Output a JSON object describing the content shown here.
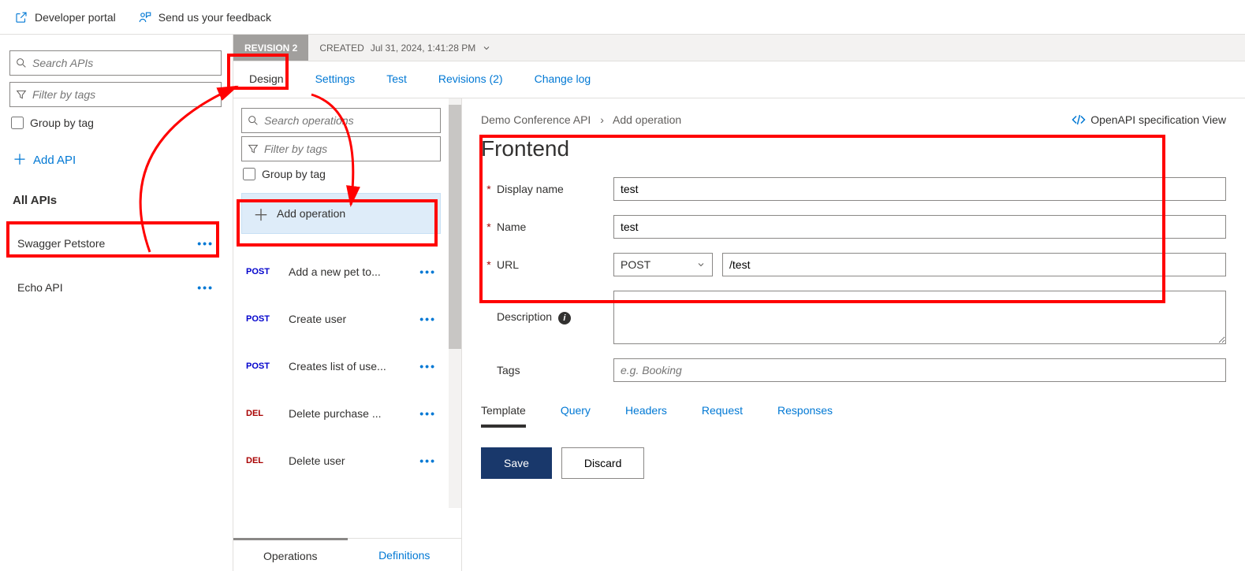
{
  "topbar": {
    "developer_portal": "Developer portal",
    "feedback": "Send us your feedback"
  },
  "sidebar": {
    "search_placeholder": "Search APIs",
    "filter_placeholder": "Filter by tags",
    "group_by_tag": "Group by tag",
    "add_api": "Add API",
    "all_apis": "All APIs",
    "apis": [
      {
        "name": "Swagger Petstore"
      },
      {
        "name": "Echo API"
      }
    ]
  },
  "revision": {
    "label": "REVISION 2",
    "created_label": "CREATED",
    "created_value": "Jul 31, 2024, 1:41:28 PM"
  },
  "tabs": {
    "design": "Design",
    "settings": "Settings",
    "test": "Test",
    "revisions": "Revisions (2)",
    "changelog": "Change log"
  },
  "ops": {
    "search_placeholder": "Search operations",
    "filter_placeholder": "Filter by tags",
    "group_by_tag": "Group by tag",
    "add_operation": "Add operation",
    "list": [
      {
        "method": "POST",
        "method_class": "post",
        "label": "Add a new pet to..."
      },
      {
        "method": "POST",
        "method_class": "post",
        "label": "Create user"
      },
      {
        "method": "POST",
        "method_class": "post",
        "label": "Creates list of use..."
      },
      {
        "method": "DEL",
        "method_class": "del",
        "label": "Delete purchase ..."
      },
      {
        "method": "DEL",
        "method_class": "del",
        "label": "Delete user"
      }
    ],
    "bottom_tabs": {
      "operations": "Operations",
      "definitions": "Definitions"
    }
  },
  "breadcrumb": {
    "api": "Demo Conference API",
    "op": "Add operation"
  },
  "openapi_link": "OpenAPI specification View",
  "frontend": {
    "heading": "Frontend",
    "display_name_label": "Display name",
    "display_name_value": "test",
    "name_label": "Name",
    "name_value": "test",
    "url_label": "URL",
    "url_method": "POST",
    "url_value": "/test",
    "description_label": "Description",
    "description_value": "",
    "tags_label": "Tags",
    "tags_placeholder": "e.g. Booking"
  },
  "subtabs": {
    "template": "Template",
    "query": "Query",
    "headers": "Headers",
    "request": "Request",
    "responses": "Responses"
  },
  "actions": {
    "save": "Save",
    "discard": "Discard"
  }
}
